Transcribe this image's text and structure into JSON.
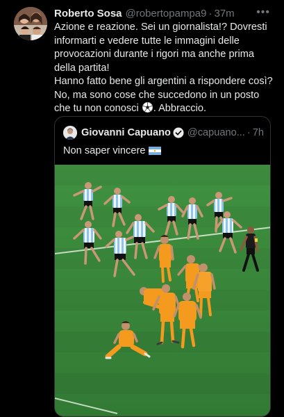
{
  "tweet": {
    "author_name": "Roberto Sosa",
    "author_handle": "@robertopampa9",
    "separator": "·",
    "time": "37m",
    "more_label": "•••",
    "paragraphs": [
      "Azione e reazione. Sei un giornalista!? Dovresti informarti e vedere tutte le immagini delle provocazioni durante i rigori ma anche prima della partita!",
      "Hanno fatto bene gli argentini a rispondere così? No, ma sono cose che succedono in un posto che tu non conosci",
      ". Abbraccio."
    ]
  },
  "quote": {
    "author_name": "Giovanni Capuano",
    "author_handle": "@capuano...",
    "separator": "·",
    "time": "7h",
    "text": "Non saper vincere"
  },
  "icons": {
    "more": "more-options-icon",
    "ball": "soccer-ball-emoji",
    "verified": "verified-badge-icon",
    "flag": "argentina-flag-emoji"
  },
  "colors": {
    "background": "#000000",
    "text": "#e7e9ea",
    "muted": "#71767b",
    "border": "#2f3336",
    "verified": "#1d9bf0",
    "pitch": "#3c8a3a",
    "argentina_shirt": "#a9d4f0",
    "netherlands_shirt": "#f39a1f"
  }
}
